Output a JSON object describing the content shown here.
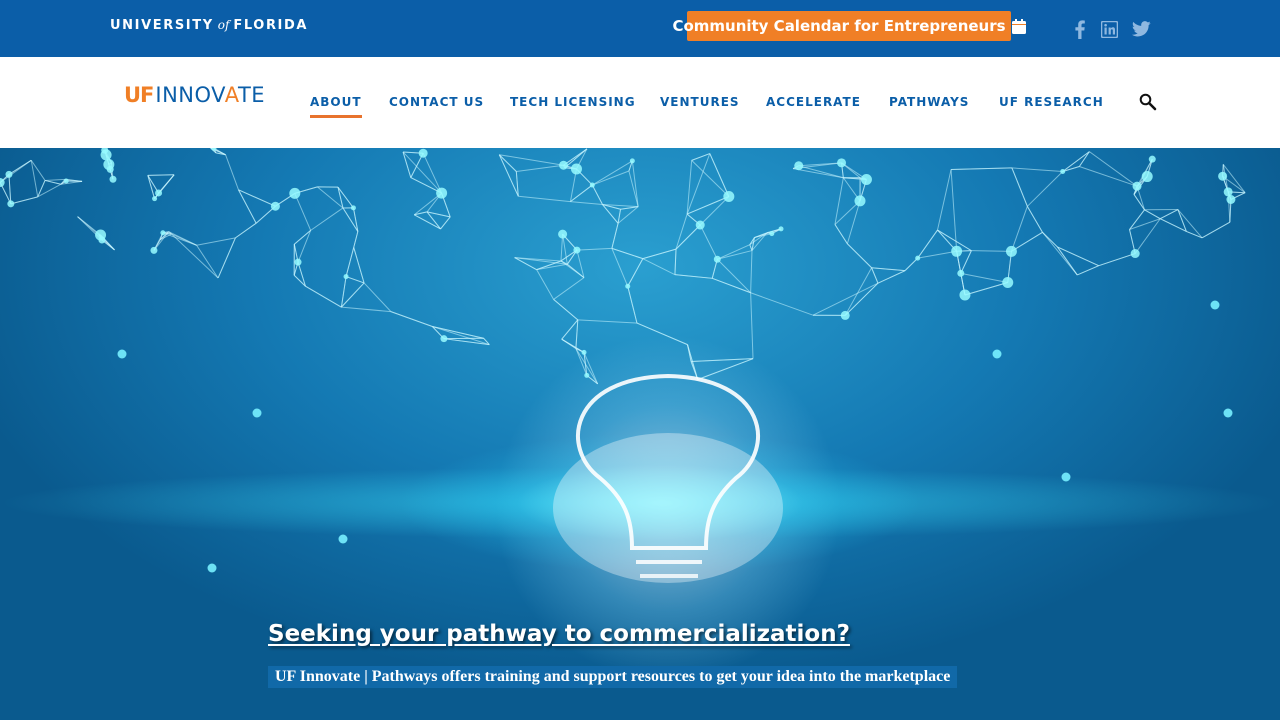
{
  "topbar": {
    "university_wordmark_pre": "UNIVERSITY",
    "university_wordmark_of": "of",
    "university_wordmark_post": "FLORIDA",
    "calendar_button_label": "Community Calendar for Entrepreneurs",
    "calendar_icon": "calendar-icon",
    "social_icons": [
      "facebook-icon",
      "linkedin-icon",
      "twitter-icon"
    ],
    "bar_color": "#0b5ea8",
    "button_color": "#f07f26"
  },
  "header": {
    "logo_prefix": "UF",
    "logo_name_part1": "INNOV",
    "logo_name_a": "A",
    "logo_name_part2": "TE",
    "nav": [
      {
        "label": "ABOUT",
        "active": true
      },
      {
        "label": "CONTACT US",
        "active": false
      },
      {
        "label": "TECH LICENSING",
        "active": false
      },
      {
        "label": "VENTURES",
        "active": false
      },
      {
        "label": "ACCELERATE",
        "active": false
      },
      {
        "label": "PATHWAYS",
        "active": false
      },
      {
        "label": "UF RESEARCH",
        "active": false
      }
    ],
    "search_icon": "search-icon",
    "accent_color": "#e8732d"
  },
  "hero": {
    "title": "Seeking your pathway to commercialization?",
    "subtitle": "UF Innovate | Pathways offers training and support resources to get your idea into the marketplace",
    "image_subject": "glowing light bulb with network of connected nodes"
  }
}
